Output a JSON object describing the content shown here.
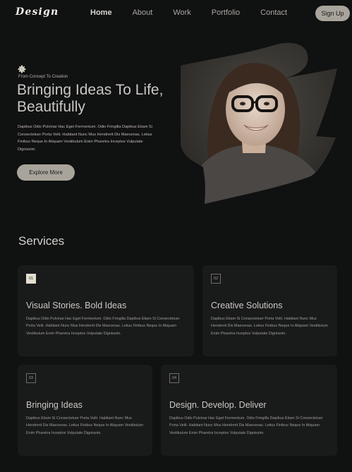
{
  "nav": {
    "logo": "Design",
    "links": [
      {
        "label": "Home",
        "active": true
      },
      {
        "label": "About",
        "active": false
      },
      {
        "label": "Work",
        "active": false
      },
      {
        "label": "Portfolio",
        "active": false
      },
      {
        "label": "Contact",
        "active": false
      }
    ],
    "signup_label": "Sign Up"
  },
  "hero": {
    "eyebrow": "From Concept To Creation",
    "title": "Bringing Ideas To Life, Beautifully",
    "text": "Dapibus Odio Pulvinar Hac Eget Fermentum. Odio Fringilla Dapibus Etiam Si Consectetuer Porta Velit. Habitant Nunc Mus Hendrerit Dis Maecenas. Letius Finibus Neque In Aliquam Vestibulum Enim Pharetra Inceptos Vulputate Dignissim.",
    "cta_label": "Explore More",
    "icon": "asterisk-flower-icon",
    "image": "portrait-of-smiling-woman-with-glasses"
  },
  "services": {
    "title": "Services",
    "cards": [
      {
        "number": "01",
        "title": "Visual Stories. Bold Ideas",
        "text": "Dapibus Odio Pulvinar Hac Eget Fermentum. Odio Fringilla Dapibus Etiam Si Consectetuer Porta Velit. Habitant Nunc Mus Hendrerit Dis Maecenas. Letius Finibus Neque In Aliquam Vestibulum Enim Pharetra Inceptos Vulputate Dignissim.",
        "highlighted": true
      },
      {
        "number": "02",
        "title": "Creative Solutions",
        "text": " Dapibus Etiam Si Consectetuer Porta Velit. Habitant Nunc Mus Hendrerit Dis Maecenas. Letius Finibus Neque In Aliquam Vestibulum Enim Pharetra Inceptos Vulputate Dignissim.",
        "highlighted": false
      },
      {
        "number": "03",
        "title": "Bringing Ideas",
        "text": " Dapibus Etiam Si Consectetuer Porta Velit. Habitant Nunc Mus Hendrerit Dis Maecenas. Letius Finibus Neque In Aliquam Vestibulum Enim Pharetra Inceptos Vulputate Dignissim.",
        "highlighted": false
      },
      {
        "number": "04",
        "title": "Design. Develop. Deliver",
        "text": "Dapibus Odio Pulvinar Hac Eget Fermentum. Odio Fringilla Dapibus Etiam Si Consectetuer Porta Velit. Habitant Nunc Mus Hendrerit Dis Maecenas. Letius Finibus Neque In Aliquam Vestibulum Enim Pharetra Inceptos Vulputate Dignissim.",
        "highlighted": false
      }
    ]
  },
  "colors": {
    "background": "#101111",
    "card": "#191a1a",
    "accent": "#a9a49b",
    "highlight_badge": "#e3dfcf"
  }
}
